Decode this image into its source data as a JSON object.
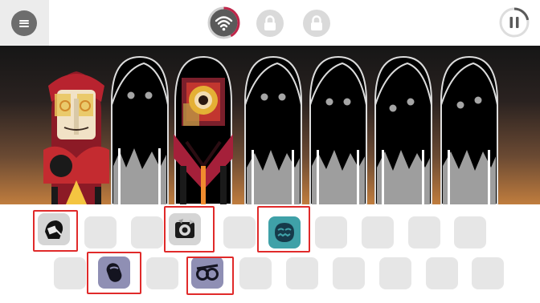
{
  "topbar": {
    "menu_icon": "hamburger-icon",
    "wifi_icon": "wifi-icon",
    "wifi_progress": 0.42,
    "lock_icon": "lock-icon",
    "pause_icon": "pause-icon",
    "pause_progress": 0.22,
    "accent": "#c0264a"
  },
  "stage": {
    "characters": [
      {
        "state": "active",
        "style": "red-gold"
      },
      {
        "state": "silhouette",
        "style": "shadow"
      },
      {
        "state": "active",
        "style": "red-rings"
      },
      {
        "state": "silhouette",
        "style": "shadow"
      },
      {
        "state": "silhouette",
        "style": "shadow"
      },
      {
        "state": "silhouette",
        "style": "shadow"
      },
      {
        "state": "silhouette",
        "style": "shadow"
      }
    ]
  },
  "tray": {
    "row1": [
      {
        "state": "selected",
        "icon": "beat-mask-icon"
      },
      {
        "state": "empty"
      },
      {
        "state": "empty"
      },
      {
        "state": "selected",
        "icon": "gear-ring-icon"
      },
      {
        "state": "empty"
      },
      {
        "state": "selected",
        "icon": "teal-mask-icon"
      },
      {
        "state": "empty"
      },
      {
        "state": "empty"
      },
      {
        "state": "empty"
      },
      {
        "state": "empty"
      }
    ],
    "row2": [
      {
        "state": "empty"
      },
      {
        "state": "selected",
        "icon": "capsule-icon"
      },
      {
        "state": "empty"
      },
      {
        "state": "selected",
        "icon": "glasses-icon"
      },
      {
        "state": "empty"
      },
      {
        "state": "empty"
      },
      {
        "state": "empty"
      },
      {
        "state": "empty"
      },
      {
        "state": "empty"
      },
      {
        "state": "empty"
      }
    ]
  }
}
